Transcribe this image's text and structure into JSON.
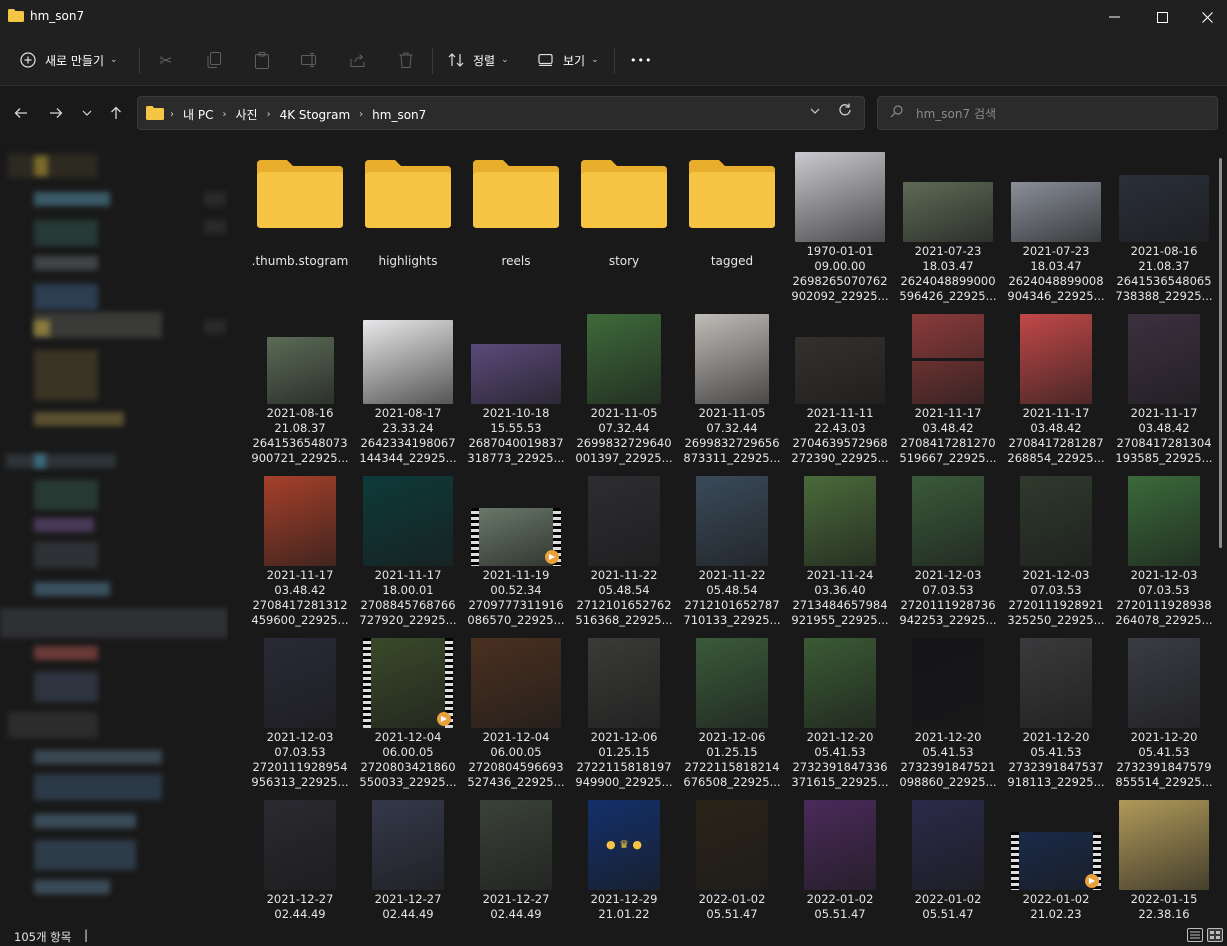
{
  "window": {
    "title": "hm_son7"
  },
  "toolbar": {
    "new_label": "새로 만들기",
    "sort_label": "정렬",
    "view_label": "보기",
    "more_label": "•••"
  },
  "address": {
    "crumbs": [
      "내 PC",
      "사진",
      "4K Stogram",
      "hm_son7"
    ]
  },
  "search": {
    "placeholder": "hm_son7 검색"
  },
  "folders": [
    ".thumb.stogram",
    "highlights",
    "reels",
    "story",
    "tagged"
  ],
  "files": [
    {
      "date": "1970-01-01",
      "time": "09.00.00",
      "id": "2698265070762",
      "tail": "902092_22925..."
    },
    {
      "date": "2021-07-23",
      "time": "18.03.47",
      "id": "2624048899000",
      "tail": "596426_22925..."
    },
    {
      "date": "2021-07-23",
      "time": "18.03.47",
      "id": "2624048899008",
      "tail": "904346_22925..."
    },
    {
      "date": "2021-08-16",
      "time": "21.08.37",
      "id": "2641536548065",
      "tail": "738388_22925..."
    },
    {
      "date": "2021-08-16",
      "time": "21.08.37",
      "id": "2641536548073",
      "tail": "900721_22925..."
    },
    {
      "date": "2021-08-17",
      "time": "23.33.24",
      "id": "2642334198067",
      "tail": "144344_22925..."
    },
    {
      "date": "2021-10-18",
      "time": "15.55.53",
      "id": "2687040019837",
      "tail": "318773_22925..."
    },
    {
      "date": "2021-11-05",
      "time": "07.32.44",
      "id": "2699832729640",
      "tail": "001397_22925..."
    },
    {
      "date": "2021-11-05",
      "time": "07.32.44",
      "id": "2699832729656",
      "tail": "873311_22925..."
    },
    {
      "date": "2021-11-11",
      "time": "22.43.03",
      "id": "2704639572968",
      "tail": "272390_22925..."
    },
    {
      "date": "2021-11-17",
      "time": "03.48.42",
      "id": "2708417281270",
      "tail": "519667_22925..."
    },
    {
      "date": "2021-11-17",
      "time": "03.48.42",
      "id": "2708417281287",
      "tail": "268854_22925..."
    },
    {
      "date": "2021-11-17",
      "time": "03.48.42",
      "id": "2708417281304",
      "tail": "193585_22925..."
    },
    {
      "date": "2021-11-17",
      "time": "03.48.42",
      "id": "2708417281312",
      "tail": "459600_22925..."
    },
    {
      "date": "2021-11-17",
      "time": "18.00.01",
      "id": "2708845768766",
      "tail": "727920_22925..."
    },
    {
      "date": "2021-11-19",
      "time": "00.52.34",
      "id": "2709777311916",
      "tail": "086570_22925..."
    },
    {
      "date": "2021-11-22",
      "time": "05.48.54",
      "id": "2712101652762",
      "tail": "516368_22925..."
    },
    {
      "date": "2021-11-22",
      "time": "05.48.54",
      "id": "2712101652787",
      "tail": "710133_22925..."
    },
    {
      "date": "2021-11-24",
      "time": "03.36.40",
      "id": "2713484657984",
      "tail": "921955_22925..."
    },
    {
      "date": "2021-12-03",
      "time": "07.03.53",
      "id": "2720111928736",
      "tail": "942253_22925..."
    },
    {
      "date": "2021-12-03",
      "time": "07.03.53",
      "id": "2720111928921",
      "tail": "325250_22925..."
    },
    {
      "date": "2021-12-03",
      "time": "07.03.53",
      "id": "2720111928938",
      "tail": "264078_22925..."
    },
    {
      "date": "2021-12-03",
      "time": "07.03.53",
      "id": "2720111928954",
      "tail": "956313_22925..."
    },
    {
      "date": "2021-12-04",
      "time": "06.00.05",
      "id": "2720803421860",
      "tail": "550033_22925..."
    },
    {
      "date": "2021-12-04",
      "time": "06.00.05",
      "id": "2720804596693",
      "tail": "527436_22925..."
    },
    {
      "date": "2021-12-06",
      "time": "01.25.15",
      "id": "2722115818197",
      "tail": "949900_22925..."
    },
    {
      "date": "2021-12-06",
      "time": "01.25.15",
      "id": "2722115818214",
      "tail": "676508_22925..."
    },
    {
      "date": "2021-12-20",
      "time": "05.41.53",
      "id": "2732391847336",
      "tail": "371615_22925..."
    },
    {
      "date": "2021-12-20",
      "time": "05.41.53",
      "id": "2732391847521",
      "tail": "098860_22925..."
    },
    {
      "date": "2021-12-20",
      "time": "05.41.53",
      "id": "2732391847537",
      "tail": "918113_22925..."
    },
    {
      "date": "2021-12-20",
      "time": "05.41.53",
      "id": "2732391847579",
      "tail": "855514_22925..."
    },
    {
      "date": "2021-12-27",
      "time": "02.44.49",
      "id": "",
      "tail": ""
    },
    {
      "date": "2021-12-27",
      "time": "02.44.49",
      "id": "",
      "tail": ""
    },
    {
      "date": "2021-12-27",
      "time": "02.44.49",
      "id": "",
      "tail": ""
    },
    {
      "date": "2021-12-29",
      "time": "21.01.22",
      "id": "",
      "tail": ""
    },
    {
      "date": "2022-01-02",
      "time": "05.51.47",
      "id": "",
      "tail": ""
    },
    {
      "date": "2022-01-02",
      "time": "05.51.47",
      "id": "",
      "tail": ""
    },
    {
      "date": "2022-01-02",
      "time": "05.51.47",
      "id": "",
      "tail": ""
    },
    {
      "date": "2022-01-02",
      "time": "21.02.23",
      "id": "",
      "tail": ""
    },
    {
      "date": "2022-01-15",
      "time": "22.38.16",
      "id": "",
      "tail": ""
    }
  ],
  "status": {
    "count": "105개 항목",
    "cursor": "|"
  },
  "colors": {
    "accent": "#f6c543",
    "background": "#191919",
    "toolbar": "#202020"
  }
}
